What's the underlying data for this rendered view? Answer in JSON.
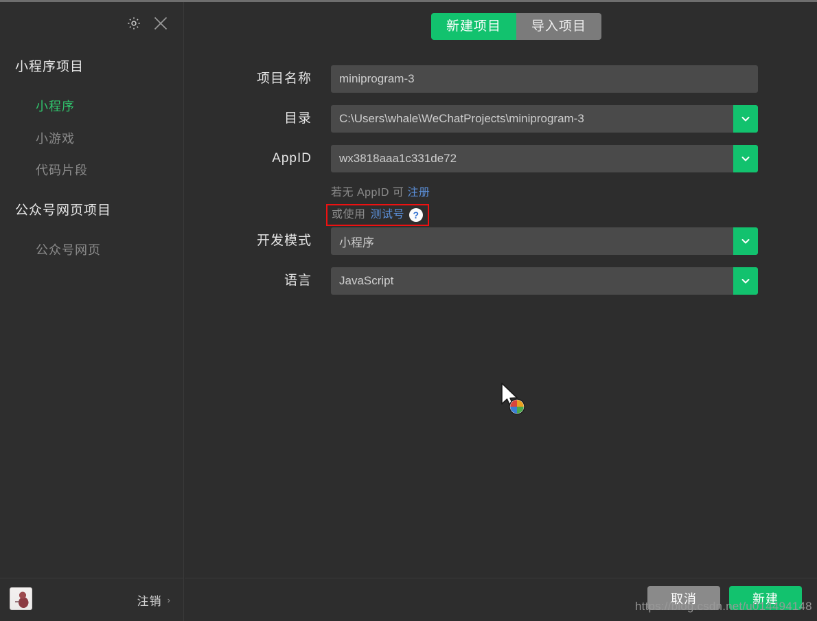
{
  "window": {
    "titlebar_icons": [
      "gear-icon",
      "close-icon"
    ]
  },
  "sidebar": {
    "sections": [
      {
        "title": "小程序项目",
        "items": [
          {
            "label": "小程序",
            "active": true
          },
          {
            "label": "小游戏",
            "active": false
          },
          {
            "label": "代码片段",
            "active": false
          }
        ]
      },
      {
        "title": "公众号网页项目",
        "items": [
          {
            "label": "公众号网页",
            "active": false
          }
        ]
      }
    ],
    "footer": {
      "logout_label": "注销",
      "logout_chevron": "›",
      "avatar": "user-avatar"
    }
  },
  "main": {
    "tabs": [
      {
        "label": "新建项目",
        "active": true
      },
      {
        "label": "导入项目",
        "active": false
      }
    ],
    "form": {
      "fields": [
        {
          "label": "项目名称",
          "value": "miniprogram-3",
          "has_dropdown": false
        },
        {
          "label": "目录",
          "value": "C:\\Users\\whale\\WeChatProjects\\miniprogram-3",
          "has_dropdown": true
        },
        {
          "label": "AppID",
          "value": "wx3818aaa1c331de72",
          "has_dropdown": true
        },
        {
          "label": "开发模式",
          "value": "小程序",
          "has_dropdown": true
        },
        {
          "label": "语言",
          "value": "JavaScript",
          "has_dropdown": true
        }
      ],
      "appid_hint": {
        "line1_prefix": "若无 AppID 可 ",
        "line1_link": "注册",
        "line2_prefix": "或使用 ",
        "line2_link": "测试号",
        "help_glyph": "?",
        "highlight_color": "#ee1111"
      }
    },
    "footer": {
      "cancel_label": "取消",
      "create_label": "新建"
    }
  },
  "watermark": "https://blog.csdn.net/u014494148",
  "colors": {
    "accent_green": "#12c26e",
    "sidebar_bg": "#2e2e2e",
    "main_bg": "#2d2d2d",
    "field_bg": "#4a4a4a",
    "link_blue": "#5b8fd8",
    "active_item": "#30c46c"
  }
}
